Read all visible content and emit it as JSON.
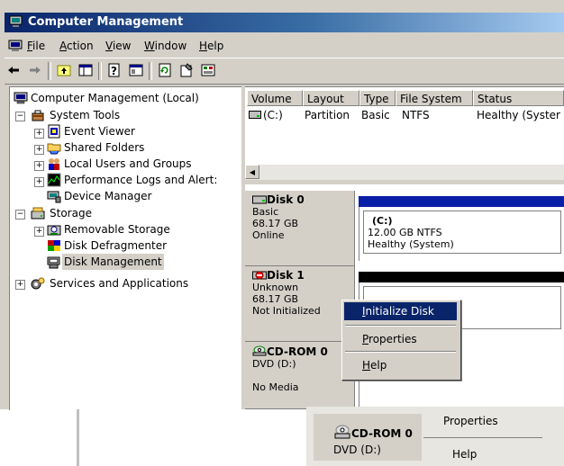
{
  "window": {
    "title": "Computer Management"
  },
  "menu": [
    {
      "label": "File",
      "accel": "F"
    },
    {
      "label": "Action",
      "accel": "A"
    },
    {
      "label": "View",
      "accel": "V"
    },
    {
      "label": "Window",
      "accel": "W"
    },
    {
      "label": "Help",
      "accel": "H"
    }
  ],
  "tree": {
    "root": "Computer Management (Local)",
    "system_tools": "System Tools",
    "event_viewer": "Event Viewer",
    "shared_folders": "Shared Folders",
    "local_users": "Local Users and Groups",
    "perf_logs": "Performance Logs and Alert:",
    "device_manager": "Device Manager",
    "storage": "Storage",
    "removable": "Removable Storage",
    "defrag": "Disk Defragmenter",
    "disk_mgmt": "Disk Management",
    "services": "Services and Applications"
  },
  "volumes": {
    "columns": [
      "Volume",
      "Layout",
      "Type",
      "File System",
      "Status"
    ],
    "rows": [
      {
        "volume": "(C:)",
        "layout": "Partition",
        "type": "Basic",
        "fs": "NTFS",
        "status": "Healthy (Syster"
      }
    ]
  },
  "disks": {
    "disk0": {
      "name": "Disk 0",
      "type": "Basic",
      "size": "68.17 GB",
      "state": "Online",
      "partition": {
        "label": "(C:)",
        "size": "12.00 GB NTFS",
        "status": "Healthy (System)"
      }
    },
    "disk1": {
      "name": "Disk 1",
      "type": "Unknown",
      "size": "68.17 GB",
      "state": "Not Initialized"
    },
    "cdrom": {
      "name": "CD-ROM 0",
      "drive": "DVD (D:)",
      "media": "No Media"
    }
  },
  "context_menu": {
    "items": [
      "Initialize Disk",
      "Properties",
      "Help"
    ],
    "accels": [
      "I",
      "P",
      "H"
    ],
    "highlighted": "Initialize Disk"
  },
  "zoom_inset": {
    "cdrom_name": "CD-ROM 0",
    "cdrom_drive": "DVD (D:)",
    "menu": [
      "Properties",
      "Help"
    ]
  },
  "colors": {
    "title_bar": "#0a246a",
    "partition_header_primary": "#0a1fa8",
    "partition_header_unallocated": "#000000",
    "selection": "#0a246a"
  }
}
